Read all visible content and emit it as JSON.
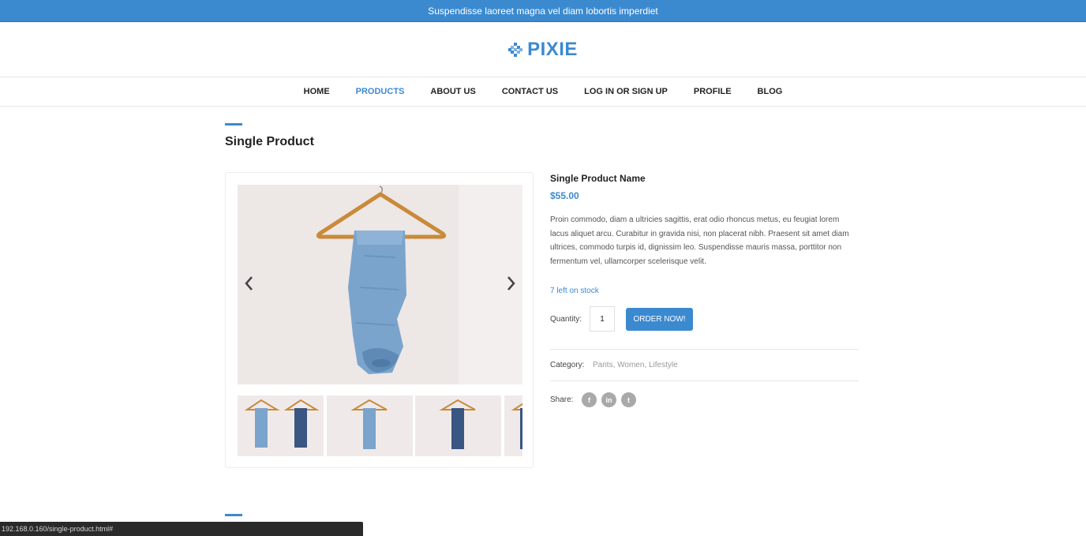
{
  "announcement": "Suspendisse laoreet magna vel diam lobortis imperdiet",
  "brand": {
    "name": "PIXIE",
    "color": "#3b8ad0"
  },
  "nav": {
    "items": [
      {
        "label": "HOME",
        "active": false
      },
      {
        "label": "PRODUCTS",
        "active": true
      },
      {
        "label": "ABOUT US",
        "active": false
      },
      {
        "label": "CONTACT US",
        "active": false
      },
      {
        "label": "LOG IN OR SIGN UP",
        "active": false
      },
      {
        "label": "PROFILE",
        "active": false
      },
      {
        "label": "BLOG",
        "active": false
      }
    ]
  },
  "page": {
    "title": "Single Product"
  },
  "gallery": {
    "prev_icon": "chevron-left-icon",
    "next_icon": "chevron-right-icon"
  },
  "product": {
    "name": "Single Product Name",
    "price": "$55.00",
    "description": "Proin commodo, diam a ultricies sagittis, erat odio rhoncus metus, eu feugiat lorem lacus aliquet arcu. Curabitur in gravida nisi, non placerat nibh. Praesent sit amet diam ultrices, commodo turpis id, dignissim leo. Suspendisse mauris massa, porttitor non fermentum vel, ullamcorper scelerisque velit.",
    "stock": "7 left on stock",
    "quantity_label": "Quantity:",
    "quantity_value": "1",
    "order_button": "ORDER NOW!",
    "category_label": "Category:",
    "categories": [
      "Pants",
      "Women",
      "Lifestyle"
    ],
    "share_label": "Share:",
    "share": [
      {
        "icon": "facebook-icon",
        "glyph": "f"
      },
      {
        "icon": "linkedin-icon",
        "glyph": "in"
      },
      {
        "icon": "twitter-icon",
        "glyph": "t"
      }
    ]
  },
  "status_bar": {
    "url": "192.168.0.160/single-product.html#"
  },
  "colors": {
    "accent": "#3b8ad0",
    "text": "#222222",
    "muted": "#999999"
  }
}
